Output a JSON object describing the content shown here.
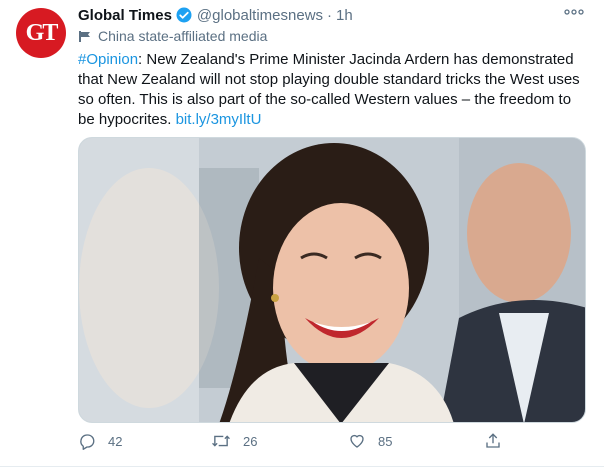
{
  "account": {
    "avatar_text": "GT",
    "name": "Global Times",
    "handle": "@globaltimesnews",
    "separator": "·",
    "time": "1h",
    "label": "China state-affiliated media"
  },
  "tweet": {
    "hashtag": "#Opinion",
    "body": ": New Zealand's Prime Minister Jacinda Ardern has demonstrated that New Zealand will not stop playing double standard tricks the West uses so often. This is also part of the so-called Western values – the freedom to be hypocrites. ",
    "link": "bit.ly/3myIltU"
  },
  "actions": {
    "replies": "42",
    "retweets": "26",
    "likes": "85"
  },
  "colors": {
    "brand_red": "#d71a22",
    "link_blue": "#1b95e0",
    "muted": "#5b7083"
  },
  "icons": {
    "more": "more-icon",
    "verified": "verified-badge-icon",
    "label": "state-media-flag-icon",
    "reply": "reply-icon",
    "retweet": "retweet-icon",
    "like": "like-icon",
    "share": "share-icon"
  }
}
